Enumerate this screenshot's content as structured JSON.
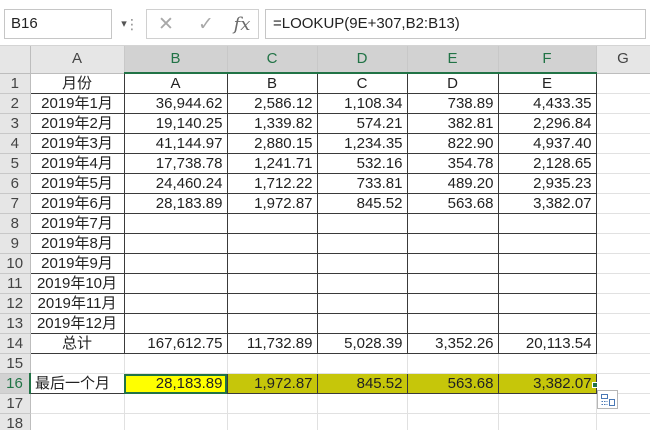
{
  "formula_bar": {
    "name_box": "B16",
    "formula": "=LOOKUP(9E+307,B2:B13)",
    "cancel_icon": "✕",
    "enter_icon": "✓",
    "fx_label": "fx"
  },
  "columns": [
    "A",
    "B",
    "C",
    "D",
    "E",
    "F",
    "G"
  ],
  "rows": [
    {
      "num": "1",
      "cells": [
        "月份",
        "A",
        "B",
        "C",
        "D",
        "E"
      ]
    },
    {
      "num": "2",
      "cells": [
        "2019年1月",
        "36,944.62",
        "2,586.12",
        "1,108.34",
        "738.89",
        "4,433.35"
      ]
    },
    {
      "num": "3",
      "cells": [
        "2019年2月",
        "19,140.25",
        "1,339.82",
        "574.21",
        "382.81",
        "2,296.84"
      ]
    },
    {
      "num": "4",
      "cells": [
        "2019年3月",
        "41,144.97",
        "2,880.15",
        "1,234.35",
        "822.90",
        "4,937.40"
      ]
    },
    {
      "num": "5",
      "cells": [
        "2019年4月",
        "17,738.78",
        "1,241.71",
        "532.16",
        "354.78",
        "2,128.65"
      ]
    },
    {
      "num": "6",
      "cells": [
        "2019年5月",
        "24,460.24",
        "1,712.22",
        "733.81",
        "489.20",
        "2,935.23"
      ]
    },
    {
      "num": "7",
      "cells": [
        "2019年6月",
        "28,183.89",
        "1,972.87",
        "845.52",
        "563.68",
        "3,382.07"
      ]
    },
    {
      "num": "8",
      "cells": [
        "2019年7月",
        "",
        "",
        "",
        "",
        ""
      ]
    },
    {
      "num": "9",
      "cells": [
        "2019年8月",
        "",
        "",
        "",
        "",
        ""
      ]
    },
    {
      "num": "10",
      "cells": [
        "2019年9月",
        "",
        "",
        "",
        "",
        ""
      ]
    },
    {
      "num": "11",
      "cells": [
        "2019年10月",
        "",
        "",
        "",
        "",
        ""
      ]
    },
    {
      "num": "12",
      "cells": [
        "2019年11月",
        "",
        "",
        "",
        "",
        ""
      ]
    },
    {
      "num": "13",
      "cells": [
        "2019年12月",
        "",
        "",
        "",
        "",
        ""
      ]
    },
    {
      "num": "14",
      "cells": [
        "总计",
        "167,612.75",
        "11,732.89",
        "5,028.39",
        "3,352.26",
        "20,113.54"
      ]
    },
    {
      "num": "15",
      "cells": [
        "",
        "",
        "",
        "",
        "",
        ""
      ]
    },
    {
      "num": "16",
      "cells": [
        "最后一个月",
        "28,183.89",
        "1,972.87",
        "845.52",
        "563.68",
        "3,382.07"
      ]
    },
    {
      "num": "17",
      "cells": [
        "",
        "",
        "",
        "",
        "",
        ""
      ]
    },
    {
      "num": "18",
      "cells": [
        "",
        "",
        "",
        "",
        "",
        ""
      ]
    }
  ],
  "colors": {
    "selection_green": "#217346",
    "highlight_yellow": "#ffff00",
    "highlight_olive": "#c6c60a"
  }
}
